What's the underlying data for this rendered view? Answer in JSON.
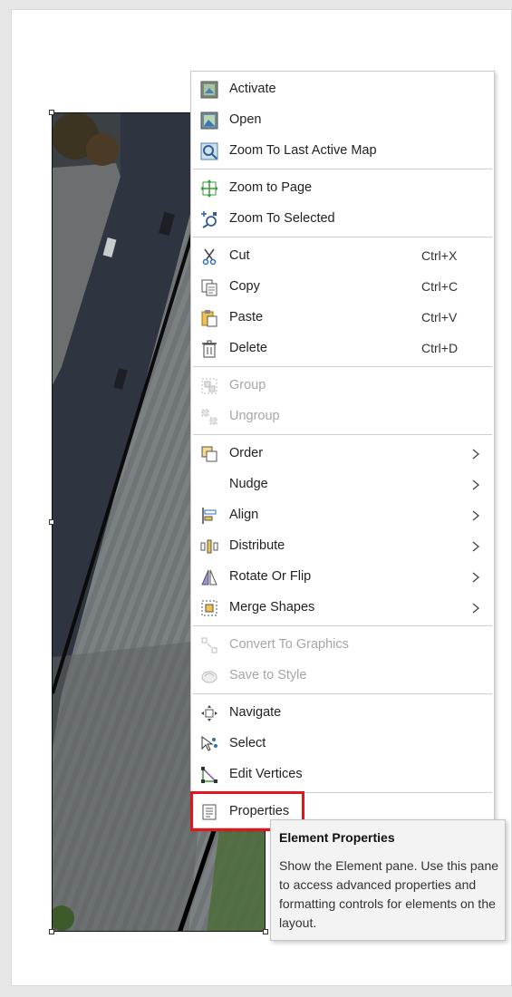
{
  "context_menu": {
    "items": [
      {
        "label": "Activate",
        "icon": "activate-icon",
        "enabled": true
      },
      {
        "label": "Open",
        "icon": "open-icon",
        "enabled": true
      },
      {
        "label": "Zoom To Last Active Map",
        "icon": "zoom-last-map-icon",
        "enabled": true
      },
      {
        "label": "Zoom to Page",
        "icon": "zoom-page-icon",
        "enabled": true
      },
      {
        "label": "Zoom To Selected",
        "icon": "zoom-selected-icon",
        "enabled": true
      },
      {
        "label": "Cut",
        "shortcut": "Ctrl+X",
        "icon": "scissors-icon",
        "enabled": true
      },
      {
        "label": "Copy",
        "shortcut": "Ctrl+C",
        "icon": "copy-icon",
        "enabled": true
      },
      {
        "label": "Paste",
        "shortcut": "Ctrl+V",
        "icon": "paste-icon",
        "enabled": true
      },
      {
        "label": "Delete",
        "shortcut": "Ctrl+D",
        "icon": "trash-icon",
        "enabled": true
      },
      {
        "label": "Group",
        "icon": "group-icon",
        "enabled": false
      },
      {
        "label": "Ungroup",
        "icon": "ungroup-icon",
        "enabled": false
      },
      {
        "label": "Order",
        "icon": "order-icon",
        "enabled": true,
        "submenu": true
      },
      {
        "label": "Nudge",
        "icon": "",
        "enabled": true,
        "submenu": true
      },
      {
        "label": "Align",
        "icon": "align-icon",
        "enabled": true,
        "submenu": true
      },
      {
        "label": "Distribute",
        "icon": "distribute-icon",
        "enabled": true,
        "submenu": true
      },
      {
        "label": "Rotate Or Flip",
        "icon": "rotate-flip-icon",
        "enabled": true,
        "submenu": true
      },
      {
        "label": "Merge Shapes",
        "icon": "merge-shapes-icon",
        "enabled": true,
        "submenu": true
      },
      {
        "label": "Convert To Graphics",
        "icon": "convert-graphics-icon",
        "enabled": false
      },
      {
        "label": "Save to Style",
        "icon": "save-style-icon",
        "enabled": false
      },
      {
        "label": "Navigate",
        "icon": "navigate-icon",
        "enabled": true
      },
      {
        "label": "Select",
        "icon": "select-icon",
        "enabled": true
      },
      {
        "label": "Edit Vertices",
        "icon": "edit-vertices-icon",
        "enabled": true
      },
      {
        "label": "Properties",
        "icon": "properties-icon",
        "enabled": true,
        "highlighted": true
      }
    ]
  },
  "tooltip": {
    "title": "Element Properties",
    "body": "Show the Element pane.  Use this pane to access advanced properties and formatting controls for elements on the layout."
  },
  "colors": {
    "highlight_border": "#e0161f",
    "disabled_text": "#a6a6a6",
    "menu_background": "#ffffff"
  }
}
